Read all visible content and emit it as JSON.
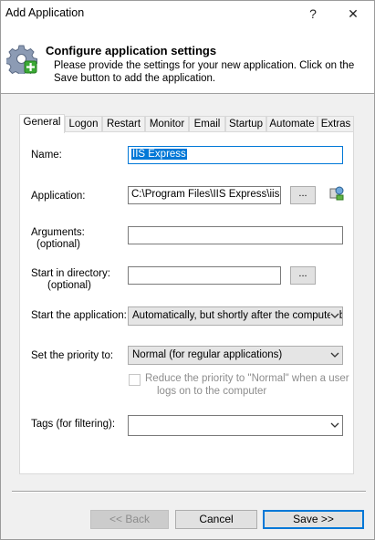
{
  "window": {
    "title": "Add Application",
    "help_symbol": "?",
    "close_symbol": "✕"
  },
  "banner": {
    "icon": "gear-plus-icon",
    "title": "Configure application settings",
    "description": "Please provide the settings for your new application. Click on the Save button to add the application."
  },
  "tabs": [
    {
      "label": "General",
      "active": true
    },
    {
      "label": "Logon"
    },
    {
      "label": "Restart"
    },
    {
      "label": "Monitor"
    },
    {
      "label": "Email"
    },
    {
      "label": "Startup"
    },
    {
      "label": "Automate"
    },
    {
      "label": "Extras"
    }
  ],
  "general": {
    "name_label": "Name:",
    "name_value": "IIS Express",
    "application_label": "Application:",
    "application_value": "C:\\Program Files\\IIS Express\\iisex",
    "browse_label": "...",
    "arguments_label": "Arguments:",
    "arguments_optional": "(optional)",
    "arguments_value": "",
    "start_dir_label": "Start in directory:",
    "start_dir_optional": "(optional)",
    "start_dir_value": "",
    "start_app_label": "Start the application:",
    "start_app_value": "Automatically, but shortly after the computer b",
    "priority_label": "Set the priority to:",
    "priority_value": "Normal (for regular applications)",
    "reduce_priority_line1": "Reduce the priority to \"Normal\" when a user",
    "reduce_priority_line2": "logs on to the computer",
    "reduce_priority_checked": false,
    "tags_label": "Tags (for filtering):",
    "tags_value": ""
  },
  "buttons": {
    "back": "<< Back",
    "cancel": "Cancel",
    "save": "Save >>"
  },
  "colors": {
    "accent": "#0078d7",
    "selection": "#0078d7"
  }
}
